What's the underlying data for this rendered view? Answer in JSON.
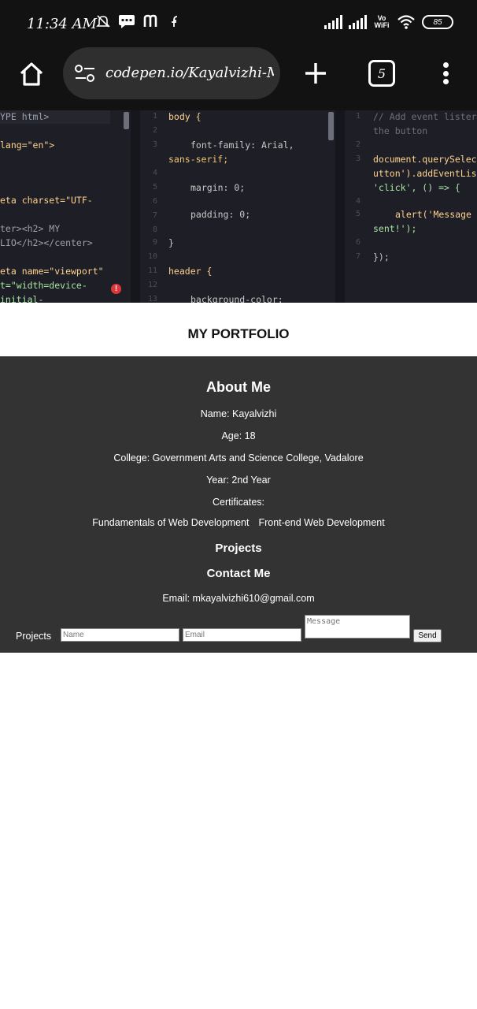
{
  "status_bar": {
    "time": "11:34 AM",
    "vo_wifi": "Vo WiFi",
    "battery": "85",
    "left_icons": [
      "mute-icon",
      "message-icon",
      "m-app-icon",
      "facebook-icon"
    ],
    "right_icons": [
      "signal-icon",
      "signal-icon",
      "vowifi-icon",
      "wifi-icon",
      "battery-icon"
    ]
  },
  "browser": {
    "url": "codepen.io/Kayalvizhi-M/",
    "tab_count": "5",
    "icons": [
      "home-icon",
      "site-settings-icon",
      "plus-icon",
      "tabs-icon",
      "more-vert-icon"
    ]
  },
  "editor": {
    "html_lines": [
      "YPE html>",
      "lang=\"en\">",
      "eta charset=\"UTF-",
      "ter><h2> MY",
      "LIO</h2></center>",
      "eta name=\"viewport\"",
      "t=\"width=device-",
      " initial-"
    ],
    "css_lines": [
      "body {",
      "font-family: Arial,",
      "sans-serif;",
      "margin: 0;",
      "padding: 0;",
      "}",
      "header {",
      "background-color:"
    ],
    "css_line_numbers": [
      "1",
      "2",
      "3",
      "4",
      "5",
      "6",
      "7",
      "8",
      "9",
      "10",
      "11",
      "12",
      "13"
    ],
    "js_lines": [
      "// Add event lister",
      "the button",
      "document.querySelec",
      "utton').addEventLis",
      "'click', () => {",
      "alert('Message",
      "sent!');",
      "});"
    ],
    "js_line_numbers": [
      "1",
      "2",
      "3",
      "4",
      "5",
      "6",
      "7"
    ]
  },
  "preview": {
    "header_title": "MY PORTFOLIO",
    "about_heading": "About Me",
    "name": "Name: Kayalvizhi",
    "age": "Age: 18",
    "college": "College: Government Arts and Science College, Vadalore",
    "year": "Year: 2nd Year",
    "certificates_label": "Certificates:",
    "certificates": [
      "Fundamentals of Web Development",
      "Front-end Web Development"
    ],
    "projects_heading": "Projects",
    "contact_heading": "Contact Me",
    "email": "Email: mkayalvizhi610@gmail.com",
    "form": {
      "label": "Projects",
      "name_placeholder": "Name",
      "email_placeholder": "Email",
      "message_placeholder": "Message",
      "send_label": "Send"
    }
  }
}
